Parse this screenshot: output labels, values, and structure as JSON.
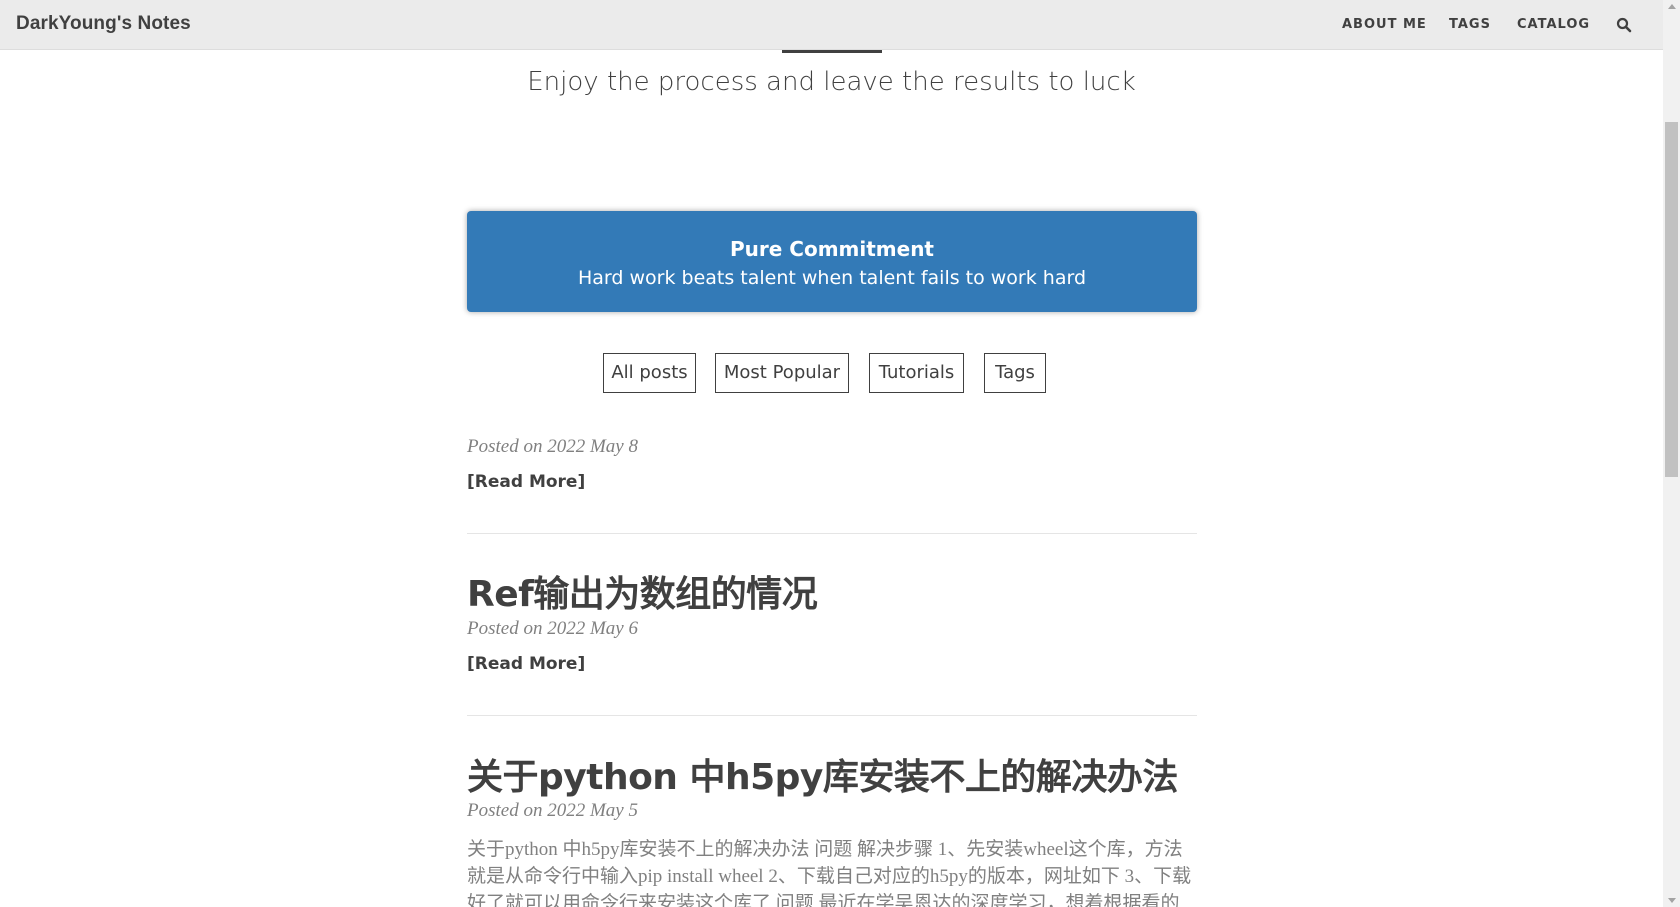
{
  "navbar": {
    "brand": "DarkYoung's Notes",
    "items": [
      {
        "label": "ABOUT ME"
      },
      {
        "label": "TAGS"
      },
      {
        "label": "CATALOG"
      }
    ],
    "search_icon": "search-icon"
  },
  "hero": {
    "subheading": "Enjoy the process and leave the results to luck"
  },
  "motto": {
    "title": "Pure Commitment",
    "text": "Hard work beats talent when talent fails to work hard",
    "color": "#337ab7"
  },
  "filters": [
    {
      "label": "All posts"
    },
    {
      "label": "Most Popular"
    },
    {
      "label": "Tutorials"
    },
    {
      "label": "Tags"
    }
  ],
  "posts": [
    {
      "meta": "Posted on 2022 May 8",
      "read_more": "[Read More]"
    },
    {
      "title": "Ref输出为数组的情况",
      "meta": "Posted on 2022 May 6",
      "read_more": "[Read More]"
    },
    {
      "title": "关于python 中h5py库安装不上的解决办法",
      "meta": "Posted on 2022 May 5",
      "excerpt": "关于python 中h5py库安装不上的解决办法 问题 解决步骤 1、先安装wheel这个库，方法就是从命令行中输入pip install wheel 2、下载自己对应的h5py的版本，网址如下 3、下载好了就可以用命令行来安装这个库了 问题 最近在学吴恩达的深度学习，想着根据看的内容写点代"
    }
  ]
}
